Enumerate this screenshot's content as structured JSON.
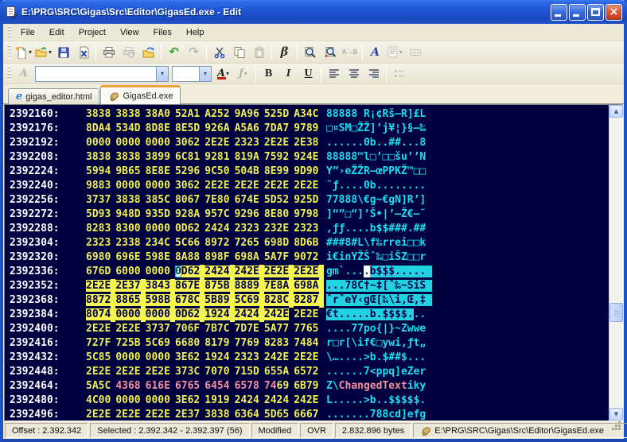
{
  "window": {
    "title": "E:\\PRG\\SRC\\Gigas\\Src\\Editor\\GigasEd.exe - Edit"
  },
  "menu": {
    "items": [
      "File",
      "Edit",
      "Project",
      "View",
      "Files",
      "Help"
    ]
  },
  "toolbar": {
    "undo_glyph": "↶",
    "redo_glyph": "↷",
    "beta_glyph": "β",
    "replace_ab_glyph": "A→B",
    "font_a_glyph": "A",
    "caret_glyph": "▾"
  },
  "format_toolbar": {
    "format_a_glyph": "A",
    "font_name": "",
    "font_size": "",
    "font_color_glyph": "A",
    "script_f_glyph": "ƒ",
    "bold_glyph": "B",
    "italic_glyph": "I",
    "underline_glyph": "U"
  },
  "tabs": [
    {
      "label": "gigas_editor.html",
      "active": false,
      "icon": "internet-explorer"
    },
    {
      "label": "GigasEd.exe",
      "active": true,
      "icon": "gigased-app"
    }
  ],
  "scrollbar": {
    "up_glyph": "▲",
    "down_glyph": "▼"
  },
  "colors": {
    "hex_bg": "#000040",
    "hex_fg": "#f0f050",
    "offset_fg": "#ffffff",
    "ascii_fg": "#17dff0",
    "sel_hex_bg": "#f5f552",
    "sel_ascii_bg": "#23d2e2",
    "sel_fg": "#000045",
    "highlight_fg": "#f2919b"
  },
  "hex": {
    "bytes_per_row": 16,
    "selection": {
      "start": 2392342,
      "end": 2392397
    },
    "cursor": 2392342,
    "highlight": {
      "start": 2392466,
      "length": 11,
      "text": "ChangedText"
    },
    "rows": [
      {
        "offset": 2392160,
        "groups": [
          "3838",
          "3838",
          "38A0",
          "52A1",
          "A252",
          "9A96",
          "525D",
          "A34C"
        ],
        "ascii": "88888 R¡¢Rš–R]£L"
      },
      {
        "offset": 2392176,
        "groups": [
          "8DA4",
          "534D",
          "8D8E",
          "8E5D",
          "926A",
          "A5A6",
          "7DA7",
          "9789"
        ],
        "ascii": "□¤SM□ŽŽ]’j¥¦}§—‰"
      },
      {
        "offset": 2392192,
        "groups": [
          "0000",
          "0000",
          "0000",
          "3062",
          "2E2E",
          "2323",
          "2E2E",
          "2E38"
        ],
        "ascii": "......0b..##...8"
      },
      {
        "offset": 2392208,
        "groups": [
          "3838",
          "3838",
          "3899",
          "6C81",
          "9281",
          "819A",
          "7592",
          "924E"
        ],
        "ascii": "88888™l□’□□šu’’N"
      },
      {
        "offset": 2392224,
        "groups": [
          "5994",
          "9B65",
          "8E8E",
          "5296",
          "9C50",
          "504B",
          "8E99",
          "9D90"
        ],
        "ascii": "Y”›eŽŽR–œPPKŽ™□□"
      },
      {
        "offset": 2392240,
        "groups": [
          "9883",
          "0000",
          "0000",
          "3062",
          "2E2E",
          "2E2E",
          "2E2E",
          "2E2E"
        ],
        "ascii": "˜ƒ....0b........"
      },
      {
        "offset": 2392256,
        "groups": [
          "3737",
          "3838",
          "385C",
          "8067",
          "7E80",
          "674E",
          "5D52",
          "925D"
        ],
        "ascii": "77888\\€g~€gN]R’]"
      },
      {
        "offset": 2392272,
        "groups": [
          "5D93",
          "948D",
          "935D",
          "928A",
          "957C",
          "9296",
          "8E80",
          "9798"
        ],
        "ascii": "]“”□“]’Š•|’–Ž€—˜"
      },
      {
        "offset": 2392288,
        "groups": [
          "8283",
          "8300",
          "0000",
          "0D62",
          "2424",
          "2323",
          "232E",
          "2323"
        ],
        "ascii": "‚ƒƒ....b$$###.##"
      },
      {
        "offset": 2392304,
        "groups": [
          "2323",
          "2338",
          "234C",
          "5C66",
          "8972",
          "7265",
          "698D",
          "8D6B"
        ],
        "ascii": "###8#L\\f‰rrei□□k"
      },
      {
        "offset": 2392320,
        "groups": [
          "6980",
          "696E",
          "598E",
          "8A88",
          "898F",
          "698A",
          "5A7F",
          "9072"
        ],
        "ascii": "i€inYŽŠˆ‰□iŠZ□□r"
      },
      {
        "offset": 2392336,
        "groups": [
          "676D",
          "6000",
          "0000",
          "0D62",
          "2424",
          "242E",
          "2E2E",
          "2E2E"
        ],
        "ascii": "gm`....b$$$....."
      },
      {
        "offset": 2392352,
        "groups": [
          "2E2E",
          "2E37",
          "3843",
          "867E",
          "875B",
          "8889",
          "7E8A",
          "698A"
        ],
        "ascii": "...78C†~‡[ˆ‰~ŠiŠ"
      },
      {
        "offset": 2392368,
        "groups": [
          "8872",
          "8865",
          "598B",
          "678C",
          "5B89",
          "5C69",
          "828C",
          "8287"
        ],
        "ascii": "ˆrˆeY‹gŒ[‰\\i‚Œ‚‡"
      },
      {
        "offset": 2392384,
        "groups": [
          "8074",
          "0000",
          "0000",
          "0D62",
          "1924",
          "2424",
          "242E",
          "2E2E"
        ],
        "ascii": "€t.....b.$$$$..."
      },
      {
        "offset": 2392400,
        "groups": [
          "2E2E",
          "2E2E",
          "3737",
          "706F",
          "7B7C",
          "7D7E",
          "5A77",
          "7765"
        ],
        "ascii": "....77po{|}~Zwwe"
      },
      {
        "offset": 2392416,
        "groups": [
          "727F",
          "725B",
          "5C69",
          "6680",
          "8179",
          "7769",
          "8283",
          "7484"
        ],
        "ascii": "r□r[\\if€□ywi‚ƒt„"
      },
      {
        "offset": 2392432,
        "groups": [
          "5C85",
          "0000",
          "0000",
          "3E62",
          "1924",
          "2323",
          "242E",
          "2E2E"
        ],
        "ascii": "\\…....>b.$##$..."
      },
      {
        "offset": 2392448,
        "groups": [
          "2E2E",
          "2E2E",
          "2E2E",
          "373C",
          "7070",
          "715D",
          "655A",
          "6572"
        ],
        "ascii": "......7<ppq]eZer"
      },
      {
        "offset": 2392464,
        "groups": [
          "5A5C",
          "4368",
          "616E",
          "6765",
          "6454",
          "6578",
          "7469",
          "6B79"
        ],
        "ascii": "Z\\ChangedTextiky"
      },
      {
        "offset": 2392480,
        "groups": [
          "4C00",
          "0000",
          "0000",
          "3E62",
          "1919",
          "2424",
          "2424",
          "242E"
        ],
        "ascii": "L.....>b..$$$$$."
      },
      {
        "offset": 2392496,
        "groups": [
          "2E2E",
          "2E2E",
          "2E2E",
          "2E37",
          "3838",
          "6364",
          "5D65",
          "6667"
        ],
        "ascii": ".......788cd]efg"
      }
    ]
  },
  "statusbar": {
    "offset": "Offset : 2.392.342",
    "selected": "Selected : 2.392.342 - 2.392.397 (56)",
    "modified": "Modified",
    "mode": "OVR",
    "size": "2.832.896 bytes",
    "path": "E:\\PRG\\SRC\\Gigas\\Src\\Editor\\GigasEd.exe"
  }
}
